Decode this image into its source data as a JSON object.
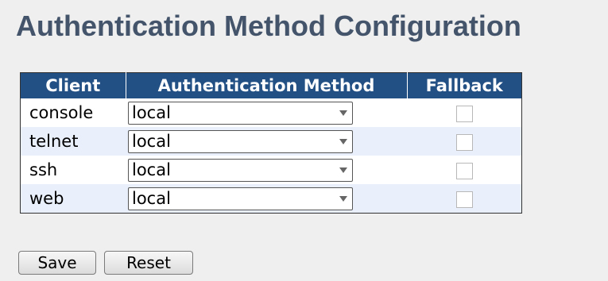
{
  "page": {
    "title": "Authentication Method Configuration"
  },
  "table": {
    "headers": {
      "client": "Client",
      "method": "Authentication Method",
      "fallback": "Fallback"
    },
    "rows": [
      {
        "client": "console",
        "method": "local",
        "fallback": false
      },
      {
        "client": "telnet",
        "method": "local",
        "fallback": false
      },
      {
        "client": "ssh",
        "method": "local",
        "fallback": false
      },
      {
        "client": "web",
        "method": "local",
        "fallback": false
      }
    ]
  },
  "buttons": {
    "save": "Save",
    "reset": "Reset"
  },
  "colors": {
    "header_bg": "#224f84",
    "title": "#44546a",
    "row_alt_bg": "#e9f0fb"
  }
}
